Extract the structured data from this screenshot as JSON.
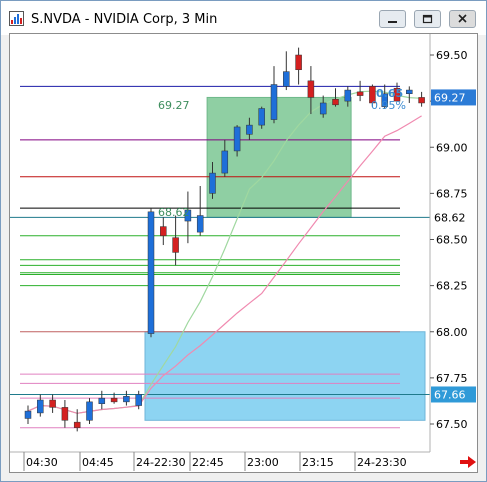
{
  "window": {
    "title": "S.NVDA - NVIDIA Corp, 3 Min",
    "controls": [
      "minimize-icon",
      "restore-icon",
      "close-icon"
    ]
  },
  "price_axis": {
    "ticks": [
      "69.50",
      "69.25",
      "69.00",
      "68.75",
      "68.50",
      "68.25",
      "68.00",
      "67.75",
      "67.50"
    ],
    "current_price_label": "69.27",
    "marker_label_1": "68.62",
    "marker_label_2": "67.66"
  },
  "time_axis": {
    "ticks": [
      "04:30",
      "04:45",
      "24-22:30",
      "22:45",
      "23:00",
      "23:15",
      "24-23:30"
    ]
  },
  "overlays": {
    "box_top_label": "69.27",
    "box_bottom_label": "68.62",
    "change_label": "0.65",
    "percent_label": "0.95%"
  },
  "colors": {
    "up_candle": "#1e6fd9",
    "down_candle": "#d42020",
    "profit_box": "#8fcfa3",
    "loss_box": "#8dd4f2",
    "price_label_bg": "#2b7bd6",
    "lower_label_bg": "#2f9ad8",
    "blue_line": "#1c1ca8",
    "green_lines": "#2bb02b",
    "pink_lines": "#e080c0",
    "ma_pink": "#f08ab0",
    "ma_green": "#a0d8a0"
  },
  "chart_data": {
    "type": "candlestick",
    "x": [
      "04:27",
      "04:30",
      "04:33",
      "04:36",
      "04:39",
      "04:42",
      "04:45",
      "04:48",
      "04:51",
      "04:54",
      "22:24",
      "22:27",
      "22:30",
      "22:33",
      "22:36",
      "22:39",
      "22:42",
      "22:45",
      "22:48",
      "22:51",
      "22:54",
      "22:57",
      "23:00",
      "23:03",
      "23:06",
      "23:09",
      "23:12",
      "23:15",
      "23:18",
      "23:21",
      "23:24",
      "23:27",
      "23:30"
    ],
    "open": [
      67.53,
      67.56,
      67.63,
      67.59,
      67.51,
      67.52,
      67.61,
      67.64,
      67.62,
      67.6,
      67.99,
      68.57,
      68.51,
      68.6,
      68.54,
      68.75,
      68.86,
      68.98,
      69.07,
      69.12,
      69.15,
      69.33,
      69.5,
      69.36,
      69.18,
      69.26,
      69.25,
      69.3,
      69.33,
      69.22,
      69.32,
      69.29,
      69.27
    ],
    "high": [
      67.6,
      67.66,
      67.66,
      67.63,
      67.58,
      67.64,
      67.68,
      67.67,
      67.68,
      67.68,
      68.67,
      68.62,
      68.63,
      68.76,
      68.79,
      68.92,
      69.04,
      69.12,
      69.16,
      69.22,
      69.44,
      69.52,
      69.54,
      69.44,
      69.28,
      69.32,
      69.33,
      69.36,
      69.34,
      69.34,
      69.35,
      69.33,
      69.3
    ],
    "low": [
      67.5,
      67.54,
      67.56,
      67.48,
      67.46,
      67.5,
      67.58,
      67.61,
      67.6,
      67.58,
      67.97,
      68.47,
      68.36,
      68.48,
      68.52,
      68.72,
      68.84,
      68.95,
      69.04,
      69.1,
      69.13,
      69.31,
      69.34,
      69.18,
      69.16,
      69.22,
      69.22,
      69.25,
      69.22,
      69.21,
      69.26,
      69.24,
      69.22
    ],
    "close": [
      67.57,
      67.63,
      67.59,
      67.52,
      67.48,
      67.62,
      67.64,
      67.62,
      67.65,
      67.66,
      68.65,
      68.52,
      68.43,
      68.66,
      68.63,
      68.86,
      68.98,
      69.11,
      69.12,
      69.21,
      69.34,
      69.41,
      69.42,
      69.27,
      69.24,
      69.23,
      69.31,
      69.28,
      69.24,
      69.29,
      69.25,
      69.31,
      69.24
    ],
    "ylim": [
      67.42,
      69.62
    ],
    "horizontal_lines": [
      {
        "price": 69.33,
        "color": "#1c1ca8"
      },
      {
        "price": 69.04,
        "color": "#800080"
      },
      {
        "price": 68.84,
        "color": "#c01010"
      },
      {
        "price": 68.67,
        "color": "#000000"
      },
      {
        "price": 68.62,
        "color": "#1f7a8c"
      },
      {
        "price": 68.52,
        "color": "#2bb02b"
      },
      {
        "price": 68.39,
        "color": "#2bb02b"
      },
      {
        "price": 68.36,
        "color": "#2bb02b"
      },
      {
        "price": 68.32,
        "color": "#2bb02b"
      },
      {
        "price": 68.31,
        "color": "#2bb02b"
      },
      {
        "price": 68.25,
        "color": "#2bb02b"
      },
      {
        "price": 68.0,
        "color": "#c06060"
      },
      {
        "price": 67.77,
        "color": "#e080c0"
      },
      {
        "price": 67.72,
        "color": "#e080c0"
      },
      {
        "price": 67.64,
        "color": "#e080c0"
      },
      {
        "price": 67.48,
        "color": "#e080c0"
      },
      {
        "price": 67.66,
        "color": "#1f7a8c"
      }
    ],
    "profit_box": {
      "top": 69.27,
      "bottom": 68.62,
      "start": "22:45",
      "end": "23:12"
    },
    "loss_box": {
      "top": 68.0,
      "bottom": 67.52,
      "start": "22:24",
      "end": "23:30"
    }
  }
}
